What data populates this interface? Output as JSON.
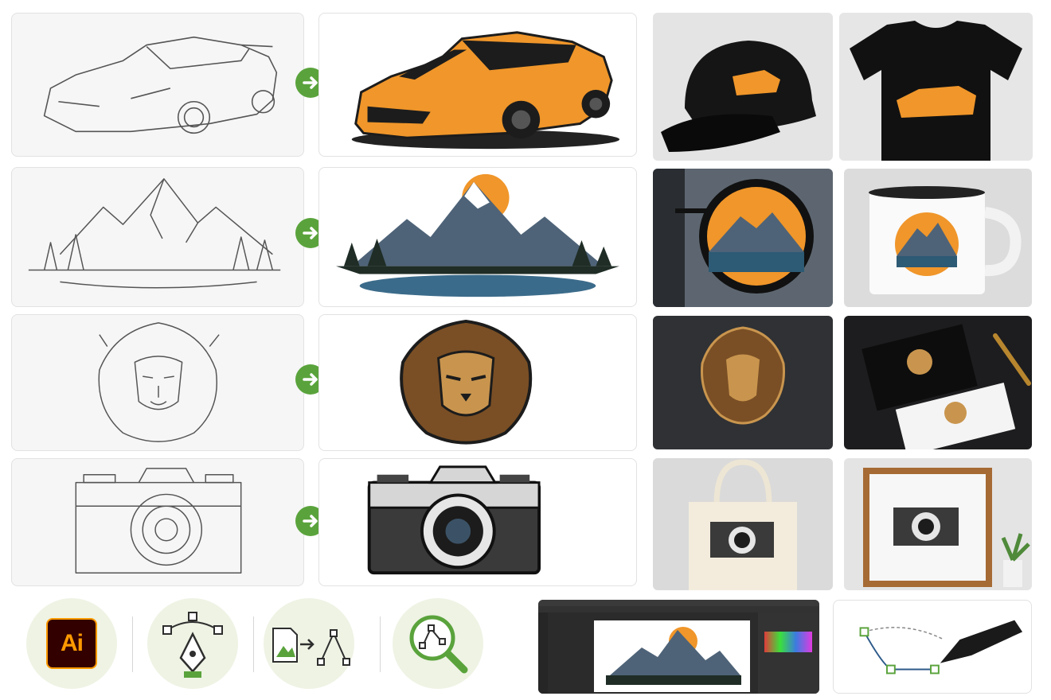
{
  "rows": [
    {
      "subject": "sports-car",
      "mockups": [
        "baseball-cap",
        "t-shirt"
      ]
    },
    {
      "subject": "mountain",
      "mockups": [
        "hanging-sign",
        "enamel-mug"
      ]
    },
    {
      "subject": "lion",
      "mockups": [
        "wall-sign",
        "business-cards"
      ]
    },
    {
      "subject": "camera",
      "mockups": [
        "tote-bag",
        "framed-print"
      ]
    }
  ],
  "colors": {
    "accent_green": "#5aa33c",
    "orange": "#f0962a",
    "dark": "#1c1c1c",
    "steel": "#4e6378",
    "gold": "#c9954e"
  },
  "icons": [
    "arrow-right-icon",
    "adobe-illustrator-icon",
    "pen-tool-icon",
    "image-to-vector-icon",
    "vector-inspect-icon"
  ],
  "ai_logo": {
    "text": "Ai"
  }
}
